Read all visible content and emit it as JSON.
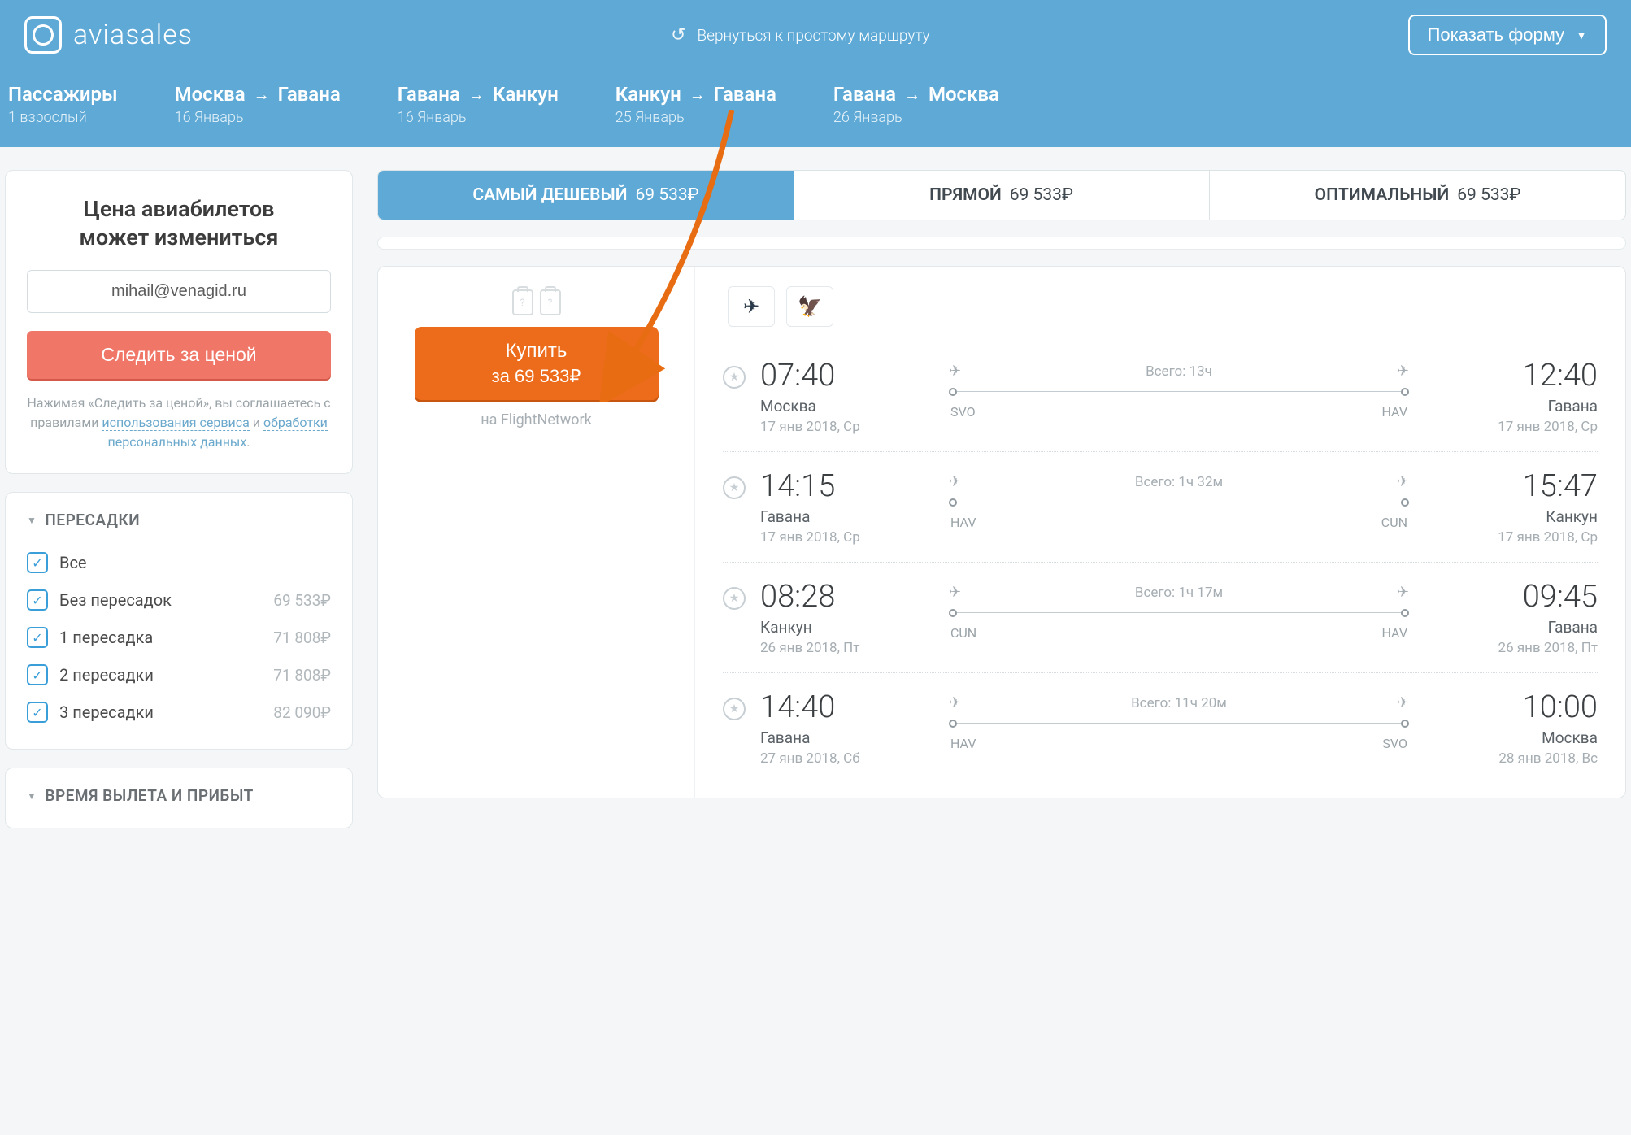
{
  "header": {
    "brand": "aviasales",
    "back_label": "Вернуться к простому маршруту",
    "show_form": "Показать форму"
  },
  "passengers": {
    "title": "Пассажиры",
    "sub": "1 взрослый"
  },
  "route": [
    {
      "from": "Москва",
      "to": "Гавана",
      "date": "16 Январь"
    },
    {
      "from": "Гавана",
      "to": "Канкун",
      "date": "16 Январь"
    },
    {
      "from": "Канкун",
      "to": "Гавана",
      "date": "25 Январь"
    },
    {
      "from": "Гавана",
      "to": "Москва",
      "date": "26 Январь"
    }
  ],
  "watch": {
    "heading_l1": "Цена авиабилетов",
    "heading_l2": "может измениться",
    "email": "mihail@venagid.ru",
    "button": "Следить за ценой",
    "legal_pre": "Нажимая «Следить за ценой», вы соглашаетесь с правилами ",
    "legal_link1": "использования сервиса",
    "legal_mid": " и ",
    "legal_link2": "обработки персональных данных",
    "legal_post": "."
  },
  "filters": {
    "transfers_title": "ПЕРЕСАДКИ",
    "departure_title": "ВРЕМЯ ВЫЛЕТА И ПРИБЫТ",
    "items": [
      {
        "label": "Все",
        "price": ""
      },
      {
        "label": "Без пересадок",
        "price": "69 533₽"
      },
      {
        "label": "1 пересадка",
        "price": "71 808₽"
      },
      {
        "label": "2 пересадки",
        "price": "71 808₽"
      },
      {
        "label": "3 пересадки",
        "price": "82 090₽"
      }
    ]
  },
  "tabs": [
    {
      "label": "САМЫЙ ДЕШЕВЫЙ",
      "price": "69 533₽"
    },
    {
      "label": "ПРЯМОЙ",
      "price": "69 533₽"
    },
    {
      "label": "ОПТИМАЛЬНЫЙ",
      "price": "69 533₽"
    }
  ],
  "result": {
    "buy_label": "Купить",
    "buy_price": "за 69 533₽",
    "seller_pre": "на ",
    "seller": "FlightNetwork",
    "airlines": [
      "✈",
      "🦅"
    ],
    "segments": [
      {
        "dep_time": "07:40",
        "dep_city": "Москва",
        "dep_date": "17 янв 2018, Ср",
        "arr_time": "12:40",
        "arr_city": "Гавана",
        "arr_date": "17 янв 2018, Ср",
        "duration": "Всего: 13ч",
        "dep_code": "SVO",
        "arr_code": "HAV"
      },
      {
        "dep_time": "14:15",
        "dep_city": "Гавана",
        "dep_date": "17 янв 2018, Ср",
        "arr_time": "15:47",
        "arr_city": "Канкун",
        "arr_date": "17 янв 2018, Ср",
        "duration": "Всего: 1ч 32м",
        "dep_code": "HAV",
        "arr_code": "CUN"
      },
      {
        "dep_time": "08:28",
        "dep_city": "Канкун",
        "dep_date": "26 янв 2018, Пт",
        "arr_time": "09:45",
        "arr_city": "Гавана",
        "arr_date": "26 янв 2018, Пт",
        "duration": "Всего: 1ч 17м",
        "dep_code": "CUN",
        "arr_code": "HAV"
      },
      {
        "dep_time": "14:40",
        "dep_city": "Гавана",
        "dep_date": "27 янв 2018, Сб",
        "arr_time": "10:00",
        "arr_city": "Москва",
        "arr_date": "28 янв 2018, Вс",
        "duration": "Всего: 11ч 20м",
        "dep_code": "HAV",
        "arr_code": "SVO"
      }
    ]
  }
}
